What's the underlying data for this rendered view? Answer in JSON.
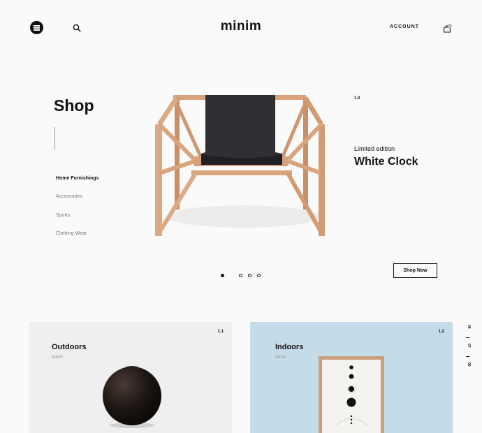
{
  "header": {
    "logo": "minim",
    "account_label": "ACCOUNT",
    "menu_icon": "hamburger-icon",
    "search_icon": "search-icon",
    "cart_icon": "shopping-bag-icon"
  },
  "hero": {
    "section_title": "Shop",
    "categories": [
      {
        "label": "Home Furnishings",
        "active": true
      },
      {
        "label": "Accessories",
        "active": false
      },
      {
        "label": "Sports",
        "active": false
      },
      {
        "label": "Clothing Wear",
        "active": false
      }
    ],
    "slide_number": "1.0",
    "product_kicker": "Limited edition",
    "product_title": "White Clock",
    "cta_label": "Shop Now",
    "pager": {
      "count": 4,
      "active_index": 0
    }
  },
  "cards": [
    {
      "title": "Outdoors",
      "subtitle": "SHOP",
      "number": "1.1",
      "background": "#efefef"
    },
    {
      "title": "Indoors",
      "subtitle": "SHOP",
      "number": "1.2",
      "background": "#c4dbea"
    }
  ],
  "side_numbers": [
    "06",
    "07",
    "08"
  ],
  "colors": {
    "text": "#111111",
    "muted": "#777777",
    "page_bg": "#fafafa",
    "wood": "#d9a37c"
  }
}
